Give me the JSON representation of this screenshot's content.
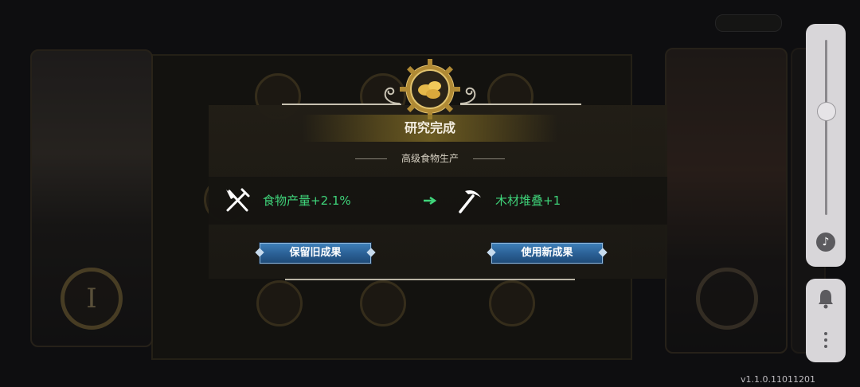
{
  "dialog": {
    "title": "研究完成",
    "research_name": "高级食物生产",
    "old_result": {
      "icon": "fork-knife-icon",
      "text": "食物产量+2.1%"
    },
    "new_result": {
      "icon": "pickaxe-icon",
      "text": "木材堆叠+1"
    },
    "keep_button": "保留旧成果",
    "use_button": "使用新成果"
  },
  "version": "v1.1.0.11011201",
  "colors": {
    "effect_green": "#3fd47a",
    "button_blue": "#2a5f94",
    "gold": "#c9a44a"
  }
}
